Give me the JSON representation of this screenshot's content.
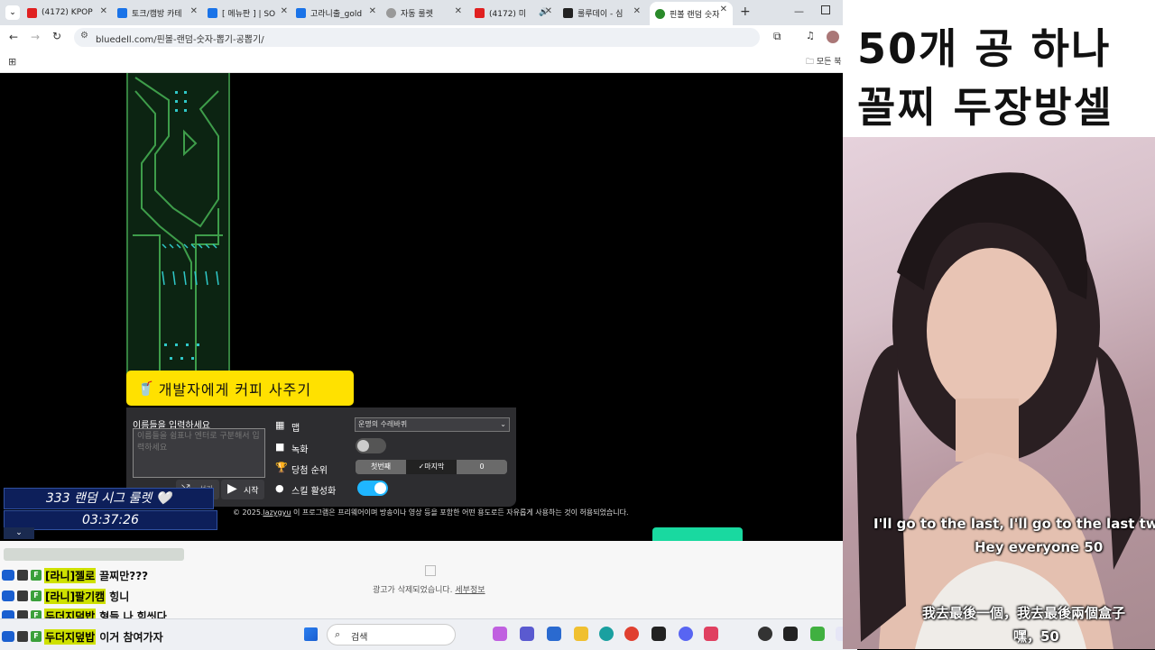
{
  "browser": {
    "tabs": [
      {
        "label": "(4172) KPOP",
        "color": "#e02020"
      },
      {
        "label": "토크/캠방 카테",
        "color": "#1a73e8"
      },
      {
        "label": "[ 메뉴판 ] | SO",
        "color": "#1a73e8"
      },
      {
        "label": "고라니출_gold",
        "color": "#1a73e8"
      },
      {
        "label": "자동 룰렛",
        "color": "#555555"
      },
      {
        "label": "(4172) 미",
        "color": "#e02020"
      },
      {
        "label": "룰루데이 - 심",
        "color": "#222222"
      },
      {
        "label": "핀볼 랜덤 숫자",
        "color": "#2a8a2a"
      }
    ],
    "new_tab": "+",
    "url": "bluedell.com/핀볼-랜덤-숫자-뽑기-공뽑기/",
    "bookmarks_folder": "모든 북"
  },
  "page": {
    "coffee_button": "개발자에게 커피 사주기",
    "names_label": "이름들을 입력하세요",
    "names_placeholder": "이름들을 쉼표나 엔터로 구분해서 입력하세요",
    "shuffle_label": "섞기",
    "start_label": "시작",
    "map_label": "맵",
    "map_value": "운명의 수레바퀴",
    "record_label": "녹화",
    "winner_rank_label": "당첨 순위",
    "rank_first": "첫번째",
    "rank_last": "마지막",
    "rank_value": "0",
    "skill_label": "스킬 활성화",
    "copyright_year": "© 2025.",
    "copyright_author": "lazygyu",
    "copyright_text": "이 프로그램은 프리웨어이며 방송이나 영상 등을 포함한 어떤 용도로든 자유롭게 사용하는 것이 허용되었습니다.",
    "ad_removed": "광고가 삭제되었습니다.",
    "ad_detail": "세부정보"
  },
  "overlay": {
    "sig_roulette": "333 랜덤 시그 룰렛 🤍",
    "timer": "03:37:26",
    "chat": [
      {
        "name": "[라니]젤로",
        "msg": "끌찌만???"
      },
      {
        "name": "[라니]팔기캠",
        "msg": "힝니"
      },
      {
        "name": "두더지덮밥",
        "msg": "형들 나 힘씻다"
      },
      {
        "name": "두더지덮밥",
        "msg": "이거 참여가자"
      }
    ]
  },
  "taskbar": {
    "search_placeholder": "검색"
  },
  "stream": {
    "caption_line1": "50개 공 하나",
    "caption_line2": "꼴찌 두장방셀",
    "subtitle_en1": "I'll go to the last, I'll go to the last two",
    "subtitle_en2": "Hey everyone 50",
    "subtitle_zh1": "我去最後一個，我去最後兩個盒子",
    "subtitle_zh2": "嘿，50"
  },
  "colors": {
    "accent_yellow": "#ffe100",
    "toggle_on": "#1fb6ff",
    "teal": "#19d9a0"
  }
}
